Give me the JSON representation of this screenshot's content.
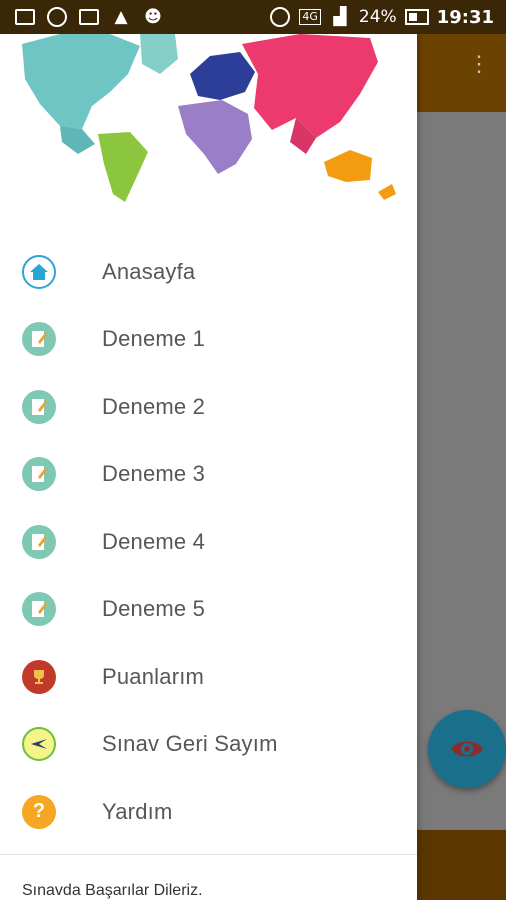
{
  "status_bar": {
    "battery_percent": "24%",
    "network": "4G",
    "time": "19:31"
  },
  "menu": [
    {
      "label": "Anasayfa",
      "icon": "home-icon"
    },
    {
      "label": "Deneme 1",
      "icon": "pencil-note-icon"
    },
    {
      "label": "Deneme 2",
      "icon": "pencil-note-icon"
    },
    {
      "label": "Deneme 3",
      "icon": "pencil-note-icon"
    },
    {
      "label": "Deneme 4",
      "icon": "pencil-note-icon"
    },
    {
      "label": "Deneme 5",
      "icon": "pencil-note-icon"
    },
    {
      "label": "Puanlarım",
      "icon": "trophy-icon"
    },
    {
      "label": "Sınav Geri Sayım",
      "icon": "countdown-icon"
    },
    {
      "label": "Yardım",
      "icon": "help-icon"
    }
  ],
  "footer": {
    "text": "Sınavda Başarılar Dileriz."
  },
  "colors": {
    "toolbar_brown": "#6c4200",
    "fab_blue": "#1a6f8d",
    "note_icon_teal": "#7ec8b4",
    "trophy_red": "#c0392b",
    "help_orange": "#f5a623"
  }
}
